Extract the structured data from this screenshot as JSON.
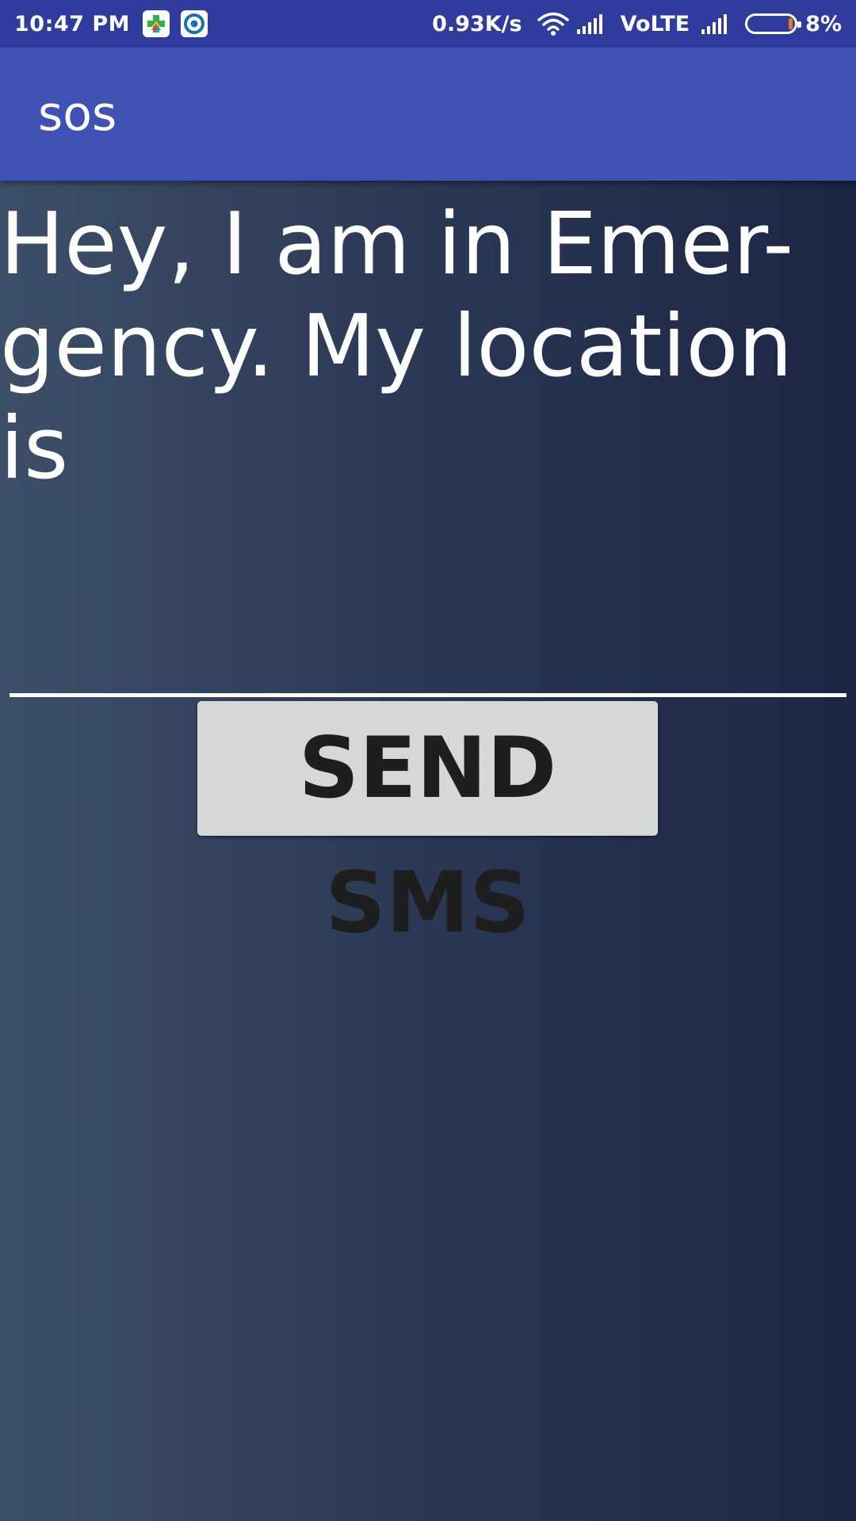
{
  "status_bar": {
    "time": "10:47 PM",
    "network_speed": "0.93K/s",
    "volte": "VoLTE",
    "battery": "8%",
    "icons": [
      "play-games-icon",
      "app-circle-icon",
      "wifi-icon",
      "signal-icon",
      "battery-icon"
    ],
    "battery_level": 0.08
  },
  "app_bar": {
    "title": "sos"
  },
  "message": {
    "lines": [
      "Hey, I am in Emer-",
      "gency. My location",
      "is"
    ]
  },
  "phone_input": {
    "value": "",
    "placeholder": ""
  },
  "send_button": {
    "label": "SEND SMS"
  },
  "colors": {
    "status_bar": "#2f3c9d",
    "app_bar": "#3f51b5",
    "background_start": "#3d4f68",
    "background_end": "#1b2644",
    "button": "#d6d7d7",
    "battery_accent": "#e07a1f"
  }
}
